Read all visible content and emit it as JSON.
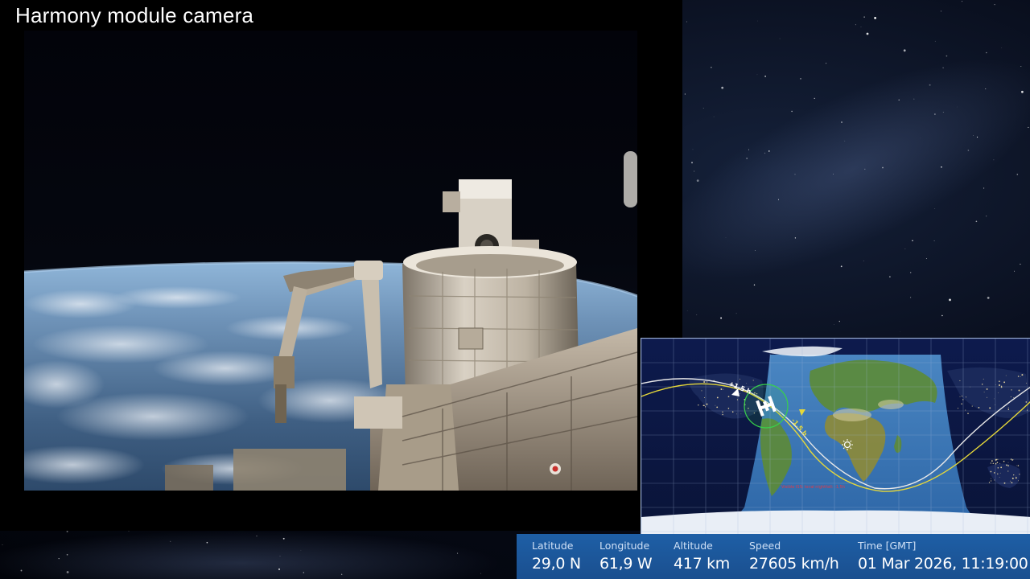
{
  "camera": {
    "title": "Harmony module camera"
  },
  "tracker_map": {
    "markers": {
      "past_label": "+1.5 h",
      "future_label": "-1.5 h"
    },
    "footnote": "Visible ISS: local nightfall: -1,5h",
    "colors": {
      "day": "#2f6fae",
      "night": "#0b1640",
      "track_past": "#e8e8e8",
      "track_future": "#e6d83a",
      "visibility_circle": "#38d24a"
    }
  },
  "telemetry": {
    "latitude": {
      "label": "Latitude",
      "value": "29,0 N"
    },
    "longitude": {
      "label": "Longitude",
      "value": "61,9 W"
    },
    "altitude": {
      "label": "Altitude",
      "value": "417 km"
    },
    "speed": {
      "label": "Speed",
      "value": "27605 km/h"
    },
    "time": {
      "label": "Time [GMT]",
      "value": "01 Mar 2026, 11:19:00"
    }
  },
  "icons": [
    "iss-icon",
    "sun-icon",
    "past-marker-icon",
    "future-marker-icon"
  ]
}
